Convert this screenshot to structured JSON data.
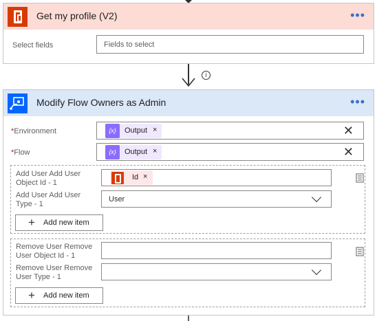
{
  "card1": {
    "title": "Get my profile (V2)",
    "more_label": "•••",
    "select_fields_label": "Select fields",
    "select_fields_placeholder": "Fields to select"
  },
  "connector": {
    "info_label": "i"
  },
  "card2": {
    "title": "Modify Flow Owners as Admin",
    "more_label": "•••",
    "required_marker": "*",
    "environment_label": "Environment",
    "environment_token": "Output",
    "flow_label": "Flow",
    "flow_token": "Output",
    "token_remove": "×",
    "token_icon_label": "{x}",
    "clear_glyph": "✕",
    "add_group": {
      "object_id_label_line1": "Add User Add User",
      "object_id_label_line2": "Object Id - 1",
      "object_id_token": "Id",
      "type_label_line1": "Add User Add User",
      "type_label_line2": "Type - 1",
      "type_value": "User",
      "add_item_label": "Add new item"
    },
    "remove_group": {
      "object_id_label_line1": "Remove User Remove",
      "object_id_label_line2": "User Object Id - 1",
      "object_id_value": "",
      "type_label_line1": "Remove User Remove",
      "type_label_line2": "User Type - 1",
      "type_value": "",
      "add_item_label": "Add new item"
    }
  },
  "icons": [
    "office-icon",
    "flow-admin-icon",
    "down-arrow-icon",
    "info-icon",
    "delete-icon",
    "plus-icon",
    "chevron-down-icon",
    "close-icon"
  ],
  "colors": {
    "card1_header": "#fcdcd5",
    "card2_header": "#dae8f8",
    "office_red": "#d83b01",
    "flow_blue": "#0066ff",
    "token_purple": "#8c6cff",
    "token_purple_bg": "#f0e8ff",
    "token_pink_bg": "#fde7e9",
    "more_blue": "#3a6fc4"
  }
}
